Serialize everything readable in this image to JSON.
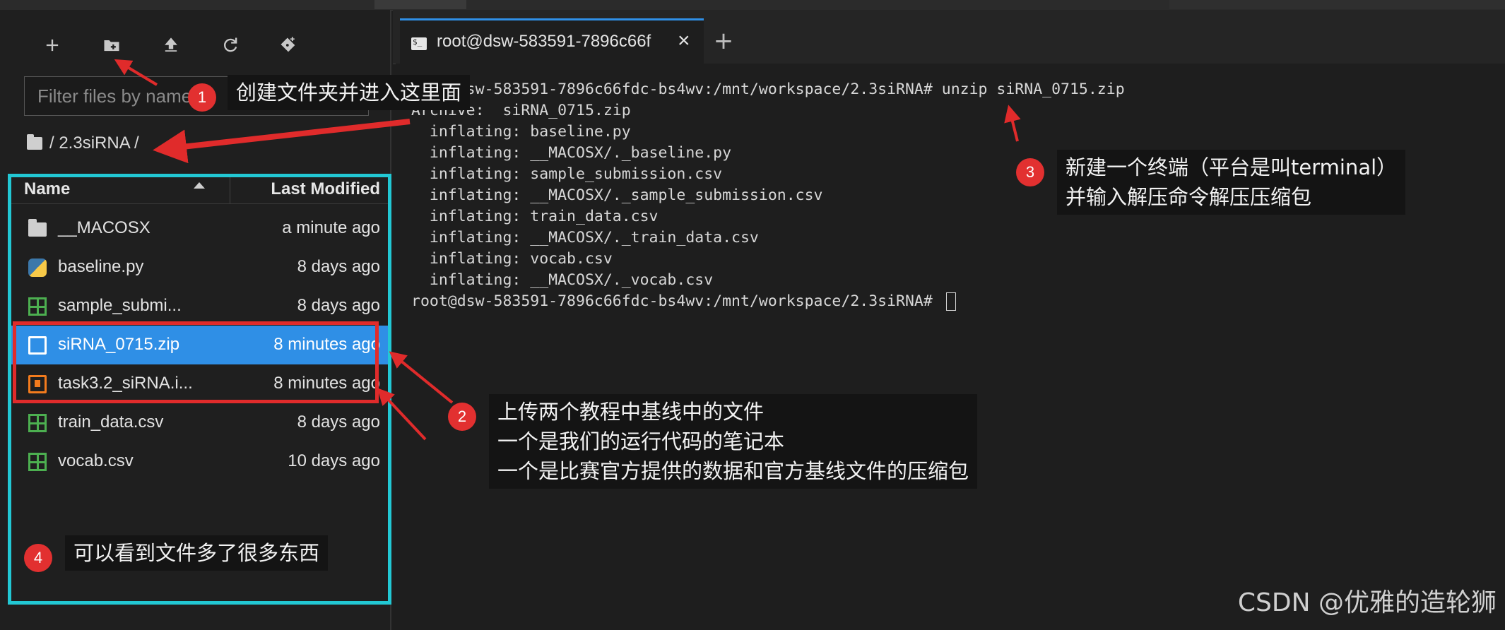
{
  "toolbar": {
    "buttons": [
      "new-launcher",
      "new-folder",
      "upload",
      "refresh",
      "clone-git"
    ]
  },
  "filebrowser": {
    "filter_placeholder": "Filter files by name",
    "breadcrumb": "/ 2.3siRNA /",
    "columns": {
      "name": "Name",
      "modified": "Last Modified"
    },
    "files": [
      {
        "name": "__MACOSX",
        "modified": "a minute ago",
        "icon": "folder-icon"
      },
      {
        "name": "baseline.py",
        "modified": "8 days ago",
        "icon": "python-file-icon"
      },
      {
        "name": "sample_submi...",
        "modified": "8 days ago",
        "icon": "csv-file-icon"
      },
      {
        "name": "siRNA_0715.zip",
        "modified": "8 minutes ago",
        "icon": "file-icon",
        "selected": true
      },
      {
        "name": "task3.2_siRNA.i...",
        "modified": "8 minutes ago",
        "icon": "notebook-icon"
      },
      {
        "name": "train_data.csv",
        "modified": "8 days ago",
        "icon": "csv-file-icon"
      },
      {
        "name": "vocab.csv",
        "modified": "10 days ago",
        "icon": "csv-file-icon"
      }
    ]
  },
  "terminal": {
    "tab_label": "root@dsw-583591-7896c66f",
    "lines": [
      "root@dsw-583591-7896c66fdc-bs4wv:/mnt/workspace/2.3siRNA# unzip siRNA_0715.zip",
      "Archive:  siRNA_0715.zip",
      "  inflating: baseline.py",
      "  inflating: __MACOSX/._baseline.py",
      "  inflating: sample_submission.csv",
      "  inflating: __MACOSX/._sample_submission.csv",
      "  inflating: train_data.csv",
      "  inflating: __MACOSX/._train_data.csv",
      "  inflating: vocab.csv",
      "  inflating: __MACOSX/._vocab.csv",
      "root@dsw-583591-7896c66fdc-bs4wv:/mnt/workspace/2.3siRNA# "
    ]
  },
  "annotations": {
    "a1": {
      "badge": "1",
      "text": "创建文件夹并进入这里面"
    },
    "a2": {
      "badge": "2",
      "text": "上传两个教程中基线中的文件\n一个是我们的运行代码的笔记本\n一个是比赛官方提供的数据和官方基线文件的压缩包"
    },
    "a3": {
      "badge": "3",
      "text": "新建一个终端（平台是叫terminal）\n并输入解压命令解压压缩包"
    },
    "a4": {
      "badge": "4",
      "text": "可以看到文件多了很多东西"
    }
  },
  "watermark": "CSDN @优雅的造轮狮",
  "colors": {
    "accent": "#2f8fe6",
    "annotation_red": "#e02b2b",
    "highlight_cyan": "#22c8d4"
  }
}
